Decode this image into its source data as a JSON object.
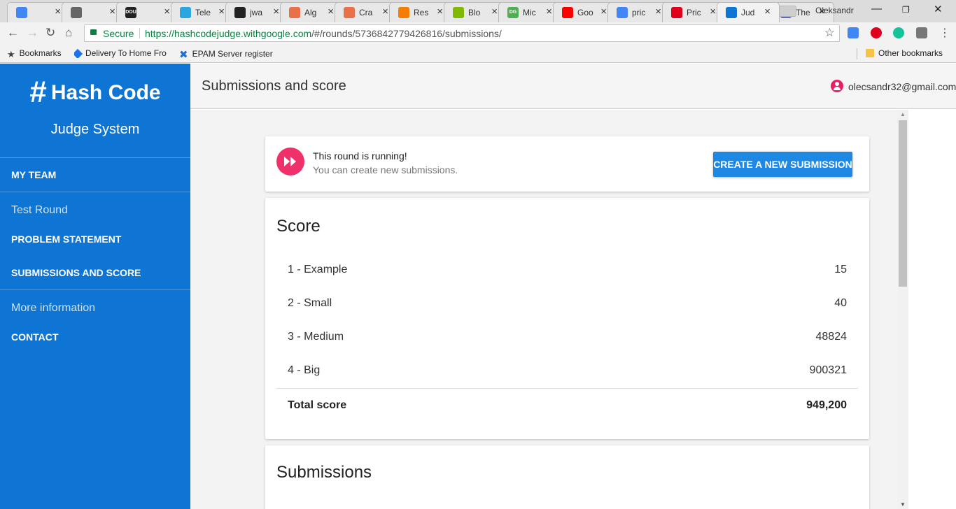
{
  "browser": {
    "tabs": [
      {
        "title": "",
        "icon": "translate-icon",
        "color": "#4285f4"
      },
      {
        "title": "",
        "icon": "hash-icon",
        "color": "#666666"
      },
      {
        "title": "",
        "icon": "dou-icon",
        "color": "#222222",
        "badge": "DOU"
      },
      {
        "title": "Tele",
        "icon": "telegram-icon",
        "color": "#2ca5e0"
      },
      {
        "title": "jwa",
        "icon": "github-icon",
        "color": "#222222"
      },
      {
        "title": "Alg",
        "icon": "page-icon",
        "color": "#e8714a"
      },
      {
        "title": "Cra",
        "icon": "page-icon",
        "color": "#e8714a"
      },
      {
        "title": "Res",
        "icon": "blogger-icon",
        "color": "#f57d00"
      },
      {
        "title": "Blo",
        "icon": "microsoft-icon",
        "color": "#7fba00"
      },
      {
        "title": "Mic",
        "icon": "dg-icon",
        "color": "#4caf50",
        "badge": "DG"
      },
      {
        "title": "Goo",
        "icon": "youtube-icon",
        "color": "#ff0000"
      },
      {
        "title": "pric",
        "icon": "google-icon",
        "color": "#4285f4"
      },
      {
        "title": "Pric",
        "icon": "opera-icon",
        "color": "#e0001b"
      },
      {
        "title": "Jud",
        "icon": "hash-color-icon",
        "color": "#0e75d5",
        "active": true
      },
      {
        "title": "The",
        "icon": "globe-icon",
        "color": "#5c6bc0"
      }
    ],
    "profile_name": "Oleksandr",
    "secure_label": "Secure",
    "url_host": "https://hashcodejudge.withgoogle.com",
    "url_path": "/#/rounds/5736842779426816/submissions/",
    "bookmarks": {
      "bookmarks_label": "Bookmarks",
      "item1": "Delivery To Home Fro",
      "item2": "EPAM Server register",
      "other": "Other bookmarks"
    }
  },
  "sidebar": {
    "logo_hash": "#",
    "logo_text": "Hash Code",
    "subtitle": "Judge System",
    "my_team": "MY TEAM",
    "round_heading": "Test Round",
    "problem_statement": "PROBLEM STATEMENT",
    "submissions_and_score": "SUBMISSIONS AND SCORE",
    "more_info_heading": "More information",
    "contact": "CONTACT"
  },
  "header": {
    "title": "Submissions and score",
    "user_email": "olecsandr32@gmail.com"
  },
  "status": {
    "title": "This round is running!",
    "subtitle": "You can create new submissions.",
    "button": "CREATE A NEW SUBMISSION",
    "accent": "#f0306a"
  },
  "score": {
    "title": "Score",
    "rows": [
      {
        "name": "1 - Example",
        "value": "15"
      },
      {
        "name": "2 - Small",
        "value": "40"
      },
      {
        "name": "3 - Medium",
        "value": "48824"
      },
      {
        "name": "4 - Big",
        "value": "900321"
      }
    ],
    "total_label": "Total score",
    "total_value": "949,200"
  },
  "submissions": {
    "title": "Submissions"
  },
  "colors": {
    "sidebar": "#0e75d5",
    "button": "#1e88e5",
    "running": "#f0306a"
  }
}
